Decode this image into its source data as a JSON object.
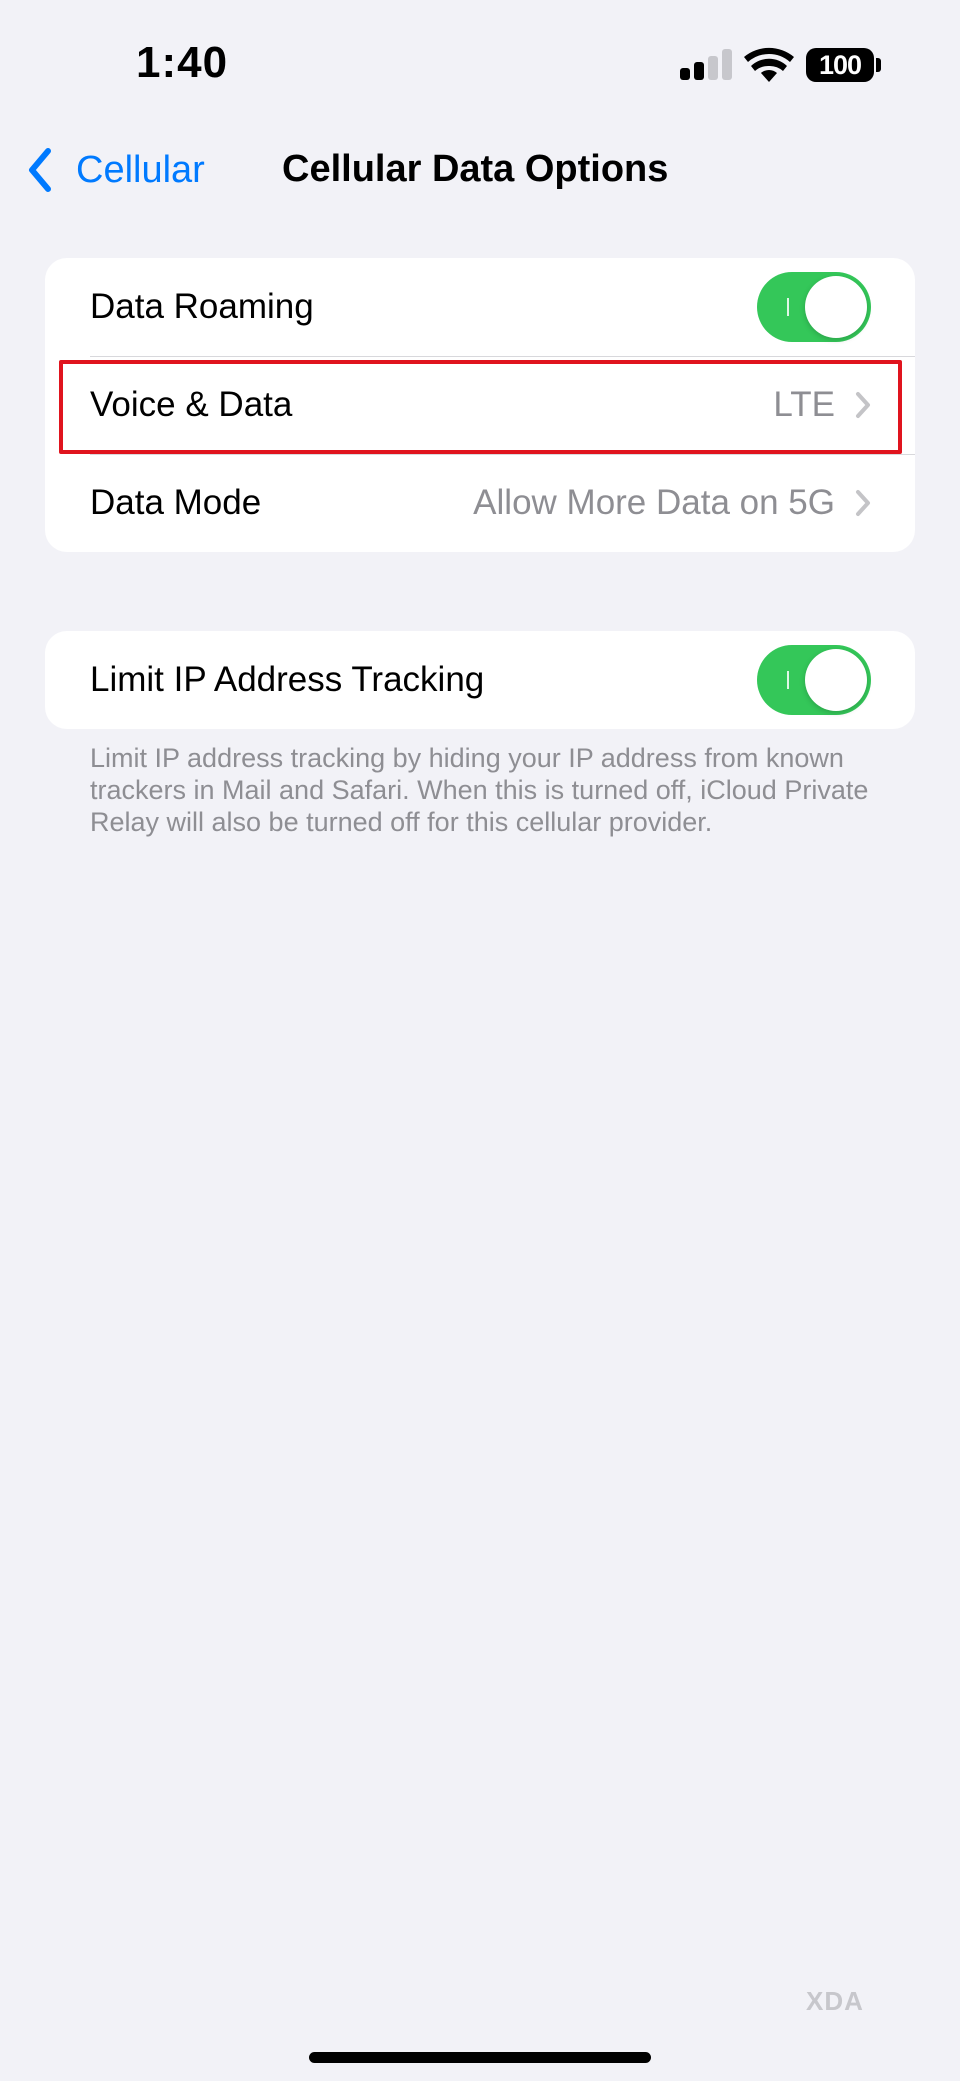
{
  "status_bar": {
    "time": "1:40",
    "battery_level": "100",
    "signal_bars_filled": 2,
    "signal_bars_total": 4
  },
  "nav": {
    "back_label": "Cellular",
    "title": "Cellular Data Options"
  },
  "group_one": {
    "data_roaming_label": "Data Roaming",
    "data_roaming_on": true,
    "voice_data_label": "Voice & Data",
    "voice_data_value": "LTE",
    "data_mode_label": "Data Mode",
    "data_mode_value": "Allow More Data on 5G"
  },
  "group_two": {
    "limit_ip_label": "Limit IP Address Tracking",
    "limit_ip_on": true,
    "footer": "Limit IP address tracking by hiding your IP address from known trackers in Mail and Safari. When this is turned off, iCloud Private Relay will also be turned off for this cellular provider."
  },
  "watermark": "XDA",
  "colors": {
    "accent": "#007aff",
    "toggle_on": "#34c759",
    "highlight": "#e0141e",
    "background": "#f2f2f7",
    "secondary_text": "#8e8e93"
  },
  "icons": {
    "back": "chevron-left-icon",
    "disclosure": "chevron-right-icon",
    "signal": "cellular-signal-icon",
    "wifi": "wifi-icon",
    "battery": "battery-icon"
  }
}
